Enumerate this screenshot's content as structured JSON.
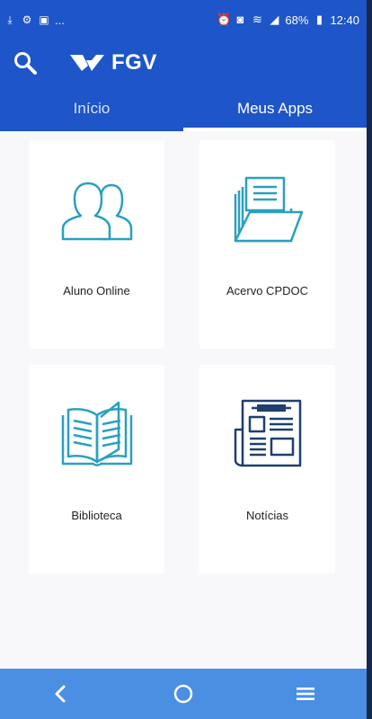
{
  "status_bar": {
    "battery_percent": "68%",
    "time": "12:40",
    "notification_overflow": "..."
  },
  "header": {
    "logo_text": "FGV"
  },
  "tabs": [
    {
      "label": "Início",
      "active": false
    },
    {
      "label": "Meus Apps",
      "active": true
    }
  ],
  "apps": [
    {
      "label": "Aluno Online",
      "icon": "users-icon"
    },
    {
      "label": "Acervo CPDOC",
      "icon": "folder-icon"
    },
    {
      "label": "Biblioteca",
      "icon": "book-icon"
    },
    {
      "label": "Notícias",
      "icon": "newspaper-icon"
    }
  ],
  "colors": {
    "primary": "#1e55c8",
    "icon_teal": "#2aa0bf",
    "icon_navy": "#1f3f6f",
    "nav_bar": "#4a8fe2"
  }
}
